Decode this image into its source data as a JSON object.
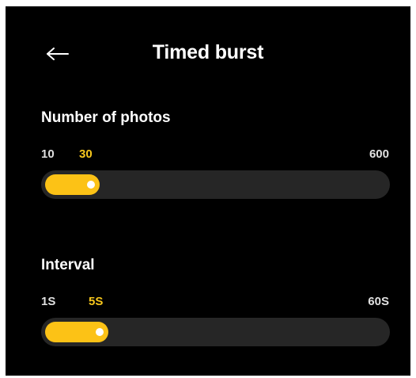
{
  "header": {
    "title": "Timed burst",
    "back_icon": "arrow-left-icon"
  },
  "photos": {
    "label": "Number of photos",
    "min": "10",
    "current": "30",
    "max": "600",
    "level": 0.02
  },
  "interval": {
    "label": "Interval",
    "min": "1S",
    "current": "5S",
    "max": "60S",
    "level": 0.07
  },
  "colors": {
    "background": "#000000",
    "accent": "#fcc216",
    "track": "#262626",
    "text": "#ffffff"
  }
}
